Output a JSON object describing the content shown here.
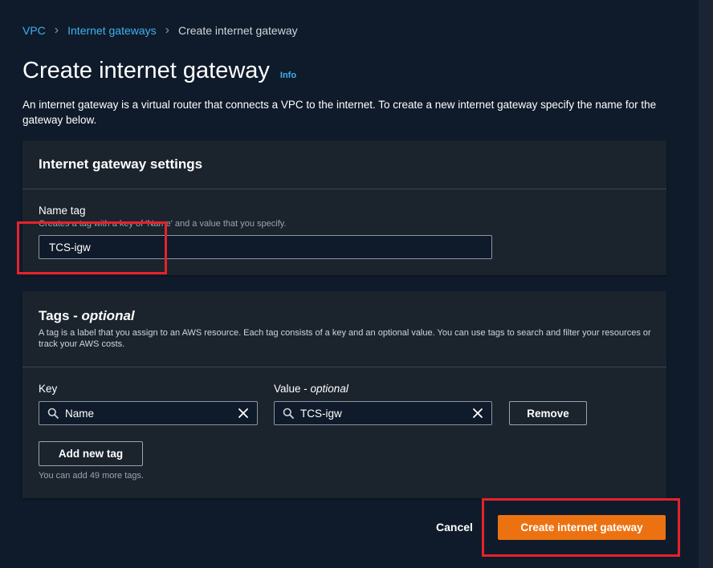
{
  "breadcrumb": {
    "items": [
      "VPC",
      "Internet gateways"
    ],
    "current": "Create internet gateway"
  },
  "page": {
    "title": "Create internet gateway",
    "info": "Info",
    "description": "An internet gateway is a virtual router that connects a VPC to the internet. To create a new internet gateway specify the name for the gateway below."
  },
  "settings": {
    "title": "Internet gateway settings",
    "name_tag_label": "Name tag",
    "name_tag_hint": "Creates a tag with a key of 'Name' and a value that you specify.",
    "name_tag_value": "TCS-igw"
  },
  "tags": {
    "title": "Tags - ",
    "title_optional": "optional",
    "description": "A tag is a label that you assign to an AWS resource. Each tag consists of a key and an optional value. You can use tags to search and filter your resources or track your AWS costs.",
    "key_label": "Key",
    "value_label": "Value - ",
    "value_optional": "optional",
    "key_value": "Name",
    "value_value": "TCS-igw",
    "remove_label": "Remove",
    "add_label": "Add new tag",
    "limit_hint": "You can add 49 more tags."
  },
  "footer": {
    "cancel_label": "Cancel",
    "create_label": "Create internet gateway"
  },
  "icons": {
    "search": "search-icon",
    "clear": "close-icon",
    "chevron": "chevron-right-icon"
  },
  "colors": {
    "background": "#0f1b2a",
    "panel": "#1b232d",
    "link": "#3fb0f0",
    "primary": "#ec7211",
    "highlight": "#e6222c"
  }
}
